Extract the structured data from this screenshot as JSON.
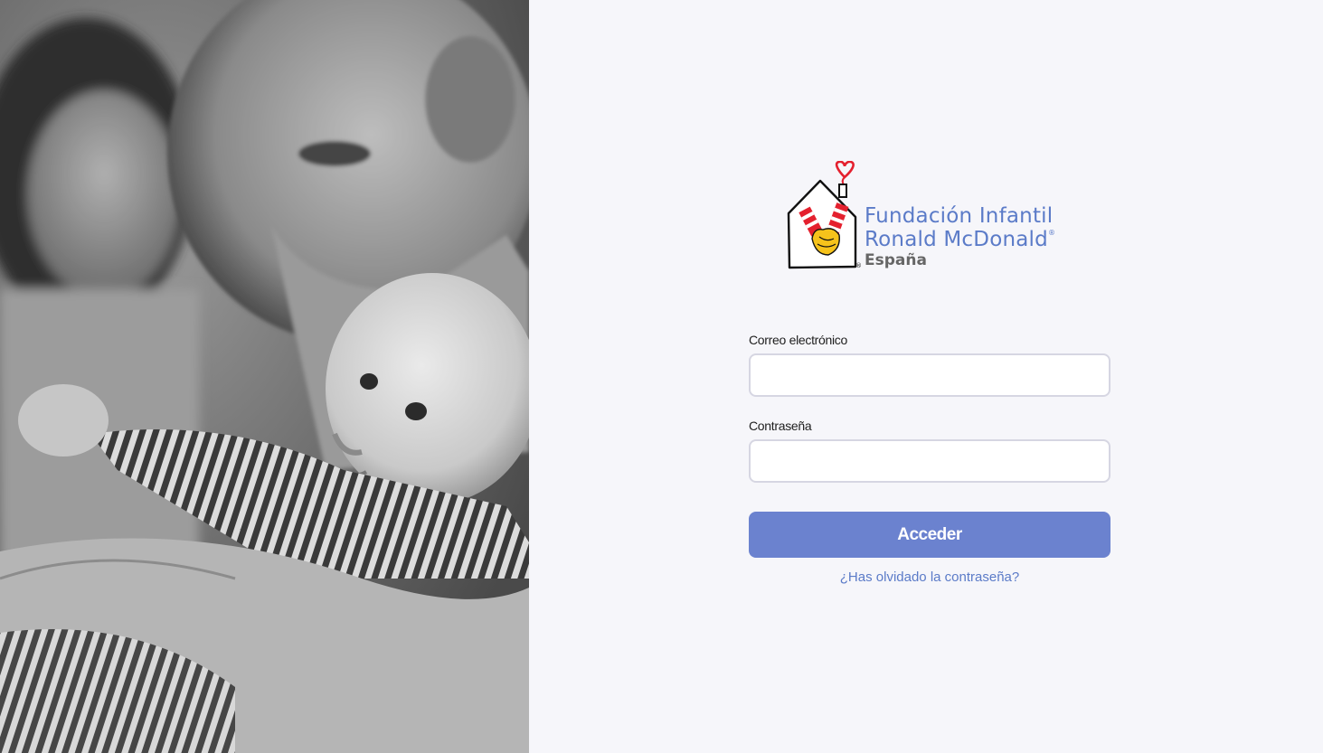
{
  "brand": {
    "line1": "Fundación Infantil",
    "line2": "Ronald McDonald",
    "registered_mark": "®",
    "country": "España",
    "colors": {
      "brand_blue": "#5b7bc8",
      "button": "#6b82cf",
      "logo_red": "#e4202e",
      "logo_yellow": "#f6c31b"
    }
  },
  "photo": {
    "icon": "family-photo",
    "style": "black-and-white"
  },
  "login": {
    "email_label": "Correo electrónico",
    "email_value": "",
    "password_label": "Contraseña",
    "password_value": "",
    "submit_label": "Acceder",
    "forgot_label": "¿Has olvidado la contraseña?"
  }
}
